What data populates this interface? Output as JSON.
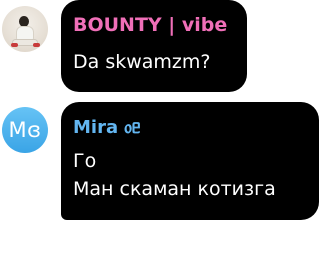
{
  "messages": [
    {
      "sender": "BOUNTY | vibe",
      "lines": [
        "Da skwamzm?"
      ],
      "sender_color": "#f06fb8"
    },
    {
      "sender": "Mira ᥆ᥱ",
      "avatar_initials": "Mɞ",
      "lines": [
        "Го",
        "Ман скаман котизга"
      ],
      "sender_color": "#63b6f1",
      "avatar_color": "#3aa4e6"
    }
  ],
  "colors": {
    "bubble_background": "#000000",
    "message_text": "#ffffff",
    "page_background": "#ffffff"
  }
}
